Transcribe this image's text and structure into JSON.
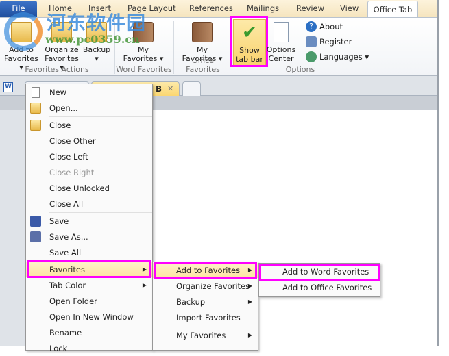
{
  "ribbon_tabs": [
    "File",
    "Home",
    "Insert",
    "Page Layout",
    "References",
    "Mailings",
    "Review",
    "View",
    "Office Tab"
  ],
  "active_tab": "Office Tab",
  "watermark": {
    "title": "河东软件园",
    "url": "www.pc0359.cn"
  },
  "groups": {
    "favorites_actions": {
      "label": "Favorites Actions",
      "buttons": [
        "Add to\nFavorites ▾",
        "Organize\nFavorites ▾",
        "Backup\n▾"
      ]
    },
    "word_favorites": {
      "label": "Word Favorites",
      "buttons": [
        "My\nFavorites ▾"
      ]
    },
    "office_favorites": {
      "label": "Office Favorites",
      "buttons": [
        "My\nFavorites ▾"
      ]
    },
    "options": {
      "label": "Options",
      "show_tab_bar": "Show\ntab bar",
      "options_center": "Options\nCenter",
      "about": "About",
      "register": "Register",
      "languages": "Languages ▾"
    }
  },
  "doc_tab": {
    "label_fragment": "B",
    "close": "✕"
  },
  "context_menu": {
    "items": [
      "New",
      "Open...",
      "Close",
      "Close Other",
      "Close Left",
      "Close Right",
      "Close Unlocked",
      "Close All",
      "Save",
      "Save As...",
      "Save All",
      "Favorites",
      "Tab Color",
      "Open Folder",
      "Open In New Window",
      "Rename",
      "Lock"
    ],
    "disabled": [
      "Close Right"
    ],
    "highlighted": "Favorites"
  },
  "favorites_submenu": {
    "items": [
      "Add to Favorites",
      "Organize Favorites",
      "Backup",
      "Import Favorites",
      "My Favorites"
    ],
    "highlighted": "Add to Favorites"
  },
  "add_submenu": {
    "items": [
      "Add to Word Favorites",
      "Add to Office Favorites"
    ],
    "highlighted": "Add to Word Favorites"
  },
  "colors": {
    "highlight_box": "#ff00ff",
    "menu_hover": "#fde3a3",
    "file_tab": "#2a5db0"
  }
}
